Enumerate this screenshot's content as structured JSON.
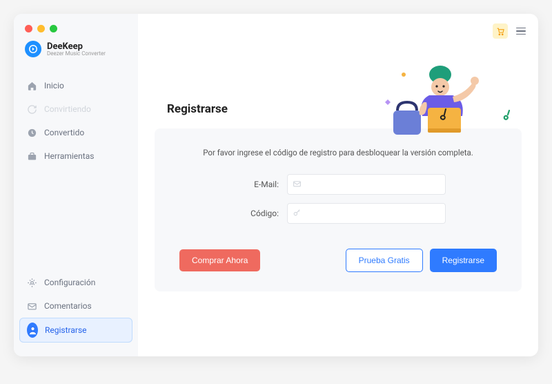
{
  "brand": {
    "name": "DeeKeep",
    "subtitle": "Deezer Music Converter"
  },
  "sidebar": {
    "items": [
      {
        "label": "Inicio"
      },
      {
        "label": "Convirtiendo"
      },
      {
        "label": "Convertido"
      },
      {
        "label": "Herramientas"
      }
    ],
    "bottom": [
      {
        "label": "Configuración"
      },
      {
        "label": "Comentarios"
      },
      {
        "label": "Registrarse"
      }
    ]
  },
  "page": {
    "title": "Registrarse",
    "message": "Por favor ingrese el código de registro para desbloquear la versión completa.",
    "email_label": "E-Mail:",
    "code_label": "Código:",
    "email_value": "",
    "code_value": "",
    "buy_label": "Comprar Ahora",
    "trial_label": "Prueba Gratis",
    "register_label": "Registrarse"
  },
  "colors": {
    "accent": "#2f7bff",
    "danger": "#ef6a5f"
  }
}
